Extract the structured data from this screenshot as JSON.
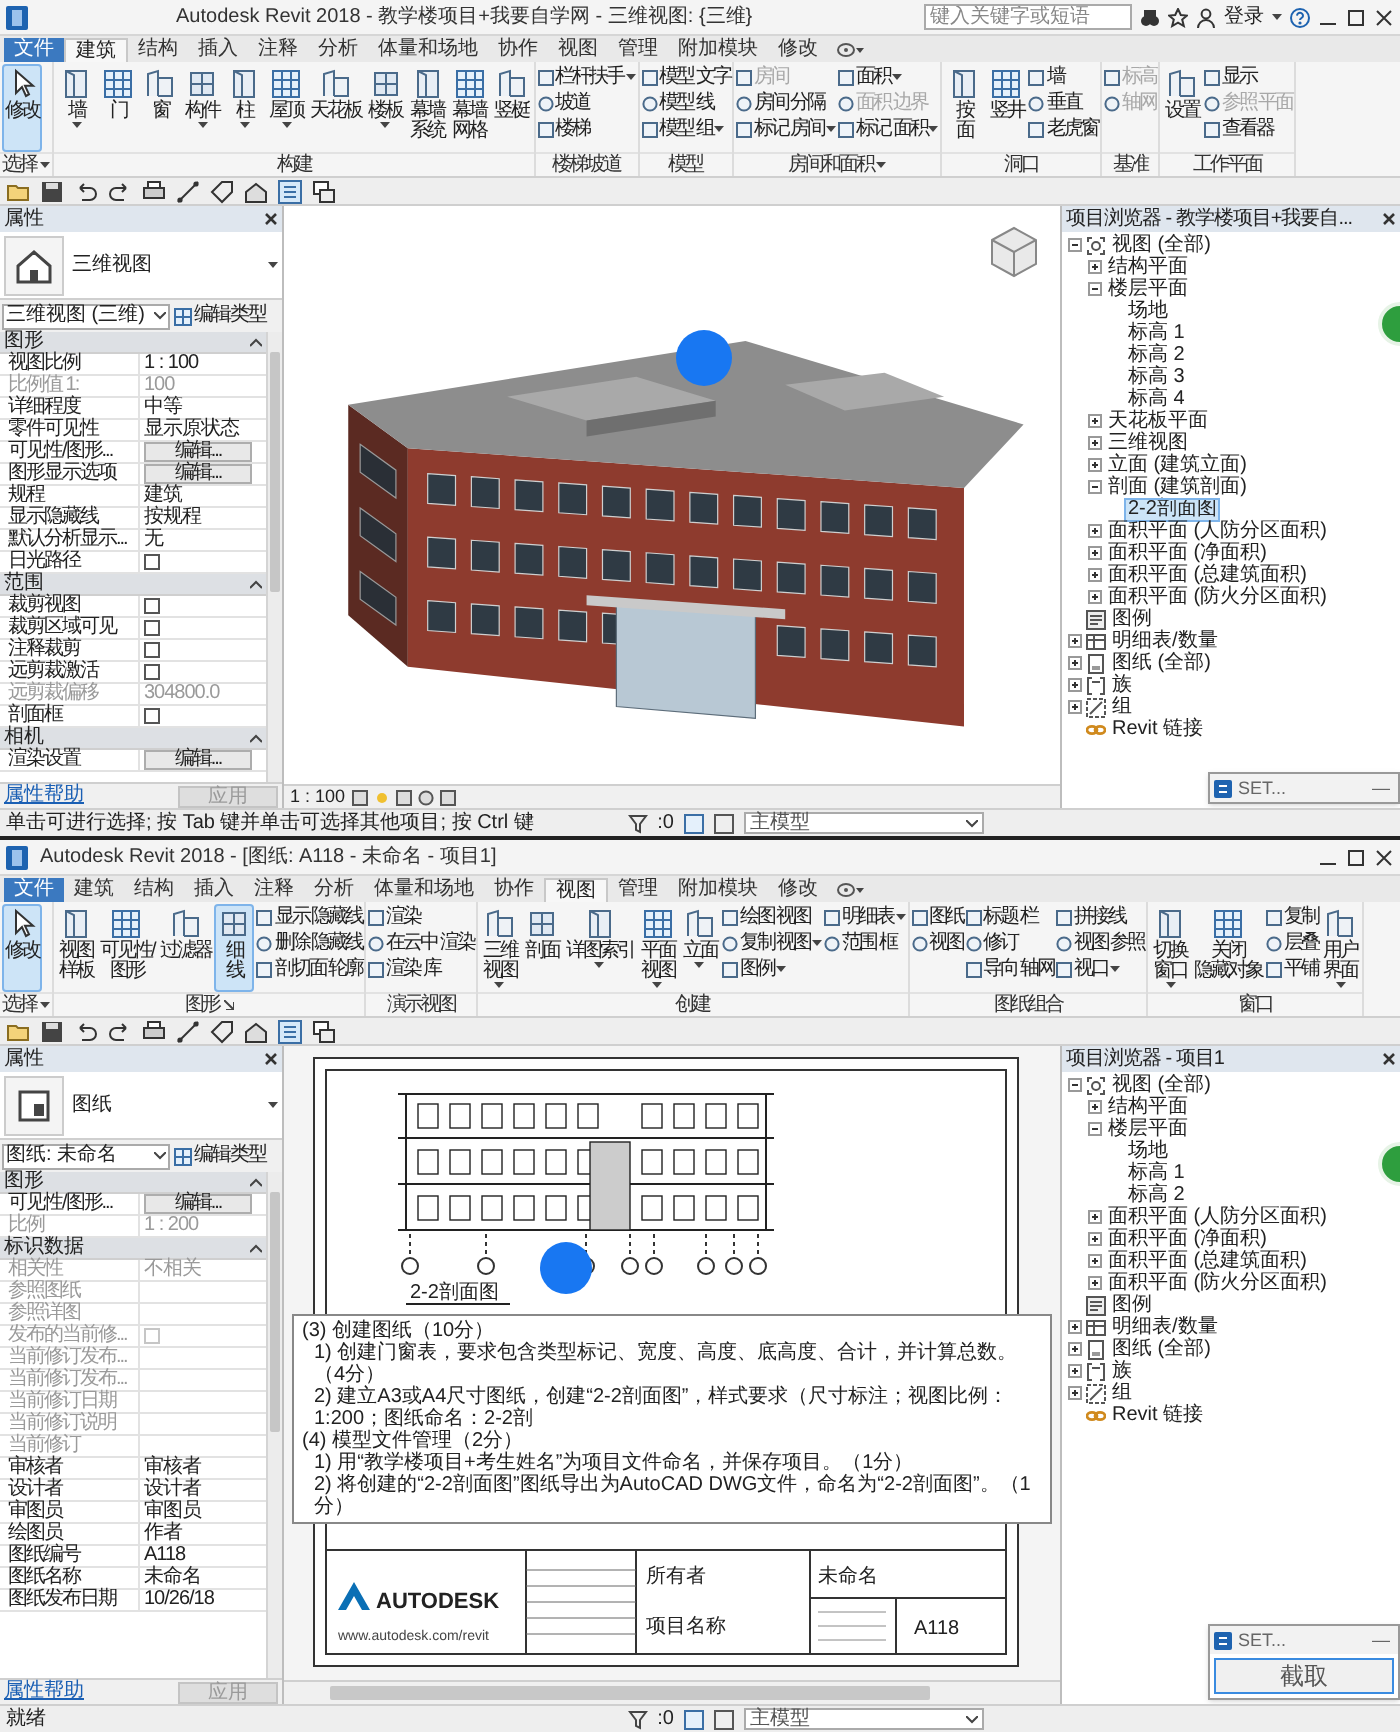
{
  "windows": [
    {
      "title": "Autodesk Revit 2018 - 教学楼项目+我要自学网 - 三维视图: {三维}",
      "search": {
        "placeholder": "键入关键字或短语"
      },
      "login": "登录",
      "tabs": [
        {
          "label": "文件",
          "kind": "file",
          "selected": false
        },
        {
          "label": "建筑",
          "kind": "tab",
          "selected": true
        },
        {
          "label": "结构",
          "kind": "tab",
          "selected": false
        },
        {
          "label": "插入",
          "kind": "tab",
          "selected": false
        },
        {
          "label": "注释",
          "kind": "tab",
          "selected": false
        },
        {
          "label": "分析",
          "kind": "tab",
          "selected": false
        },
        {
          "label": "体量和场地",
          "kind": "tab",
          "selected": false
        },
        {
          "label": "协作",
          "kind": "tab",
          "selected": false
        },
        {
          "label": "视图",
          "kind": "tab",
          "selected": false
        },
        {
          "label": "管理",
          "kind": "tab",
          "selected": false
        },
        {
          "label": "附加模块",
          "kind": "tab",
          "selected": false
        },
        {
          "label": "修改",
          "kind": "tab",
          "selected": false
        }
      ],
      "ribbon": [
        {
          "label": "选择",
          "dropdown": true,
          "launcher": false,
          "items": [
            {
              "kind": "large",
              "lines": [
                "修改"
              ],
              "dropdown": false,
              "selected": true
            }
          ]
        },
        {
          "label": "构建",
          "dropdown": false,
          "launcher": false,
          "items": [
            {
              "kind": "large",
              "lines": [
                "墙"
              ],
              "dropdown": true,
              "selected": false
            },
            {
              "kind": "large",
              "lines": [
                "门"
              ],
              "dropdown": false,
              "selected": false
            },
            {
              "kind": "large",
              "lines": [
                "窗"
              ],
              "dropdown": false,
              "selected": false
            },
            {
              "kind": "large",
              "lines": [
                "构件"
              ],
              "dropdown": true,
              "selected": false
            },
            {
              "kind": "large",
              "lines": [
                "柱"
              ],
              "dropdown": true,
              "selected": false
            },
            {
              "kind": "large",
              "lines": [
                "屋顶"
              ],
              "dropdown": true,
              "selected": false
            },
            {
              "kind": "large",
              "lines": [
                "天花板"
              ],
              "dropdown": false,
              "selected": false
            },
            {
              "kind": "large",
              "lines": [
                "楼板"
              ],
              "dropdown": true,
              "selected": false
            },
            {
              "kind": "large",
              "lines": [
                "幕墙",
                "系统"
              ],
              "dropdown": false,
              "selected": false
            },
            {
              "kind": "large",
              "lines": [
                "幕墙",
                "网格"
              ],
              "dropdown": false,
              "selected": false
            },
            {
              "kind": "large",
              "lines": [
                "竖梃"
              ],
              "dropdown": false,
              "selected": false
            }
          ]
        },
        {
          "label": "楼梯坡道",
          "dropdown": false,
          "launcher": false,
          "items": [
            {
              "kind": "column",
              "items": [
                {
                  "label": "栏杆扶手",
                  "dropdown": true,
                  "disabled": false
                },
                {
                  "label": "坡道",
                  "dropdown": false,
                  "disabled": false
                },
                {
                  "label": "楼梯",
                  "dropdown": false,
                  "disabled": false
                }
              ]
            }
          ]
        },
        {
          "label": "模型",
          "dropdown": false,
          "launcher": false,
          "items": [
            {
              "kind": "column",
              "items": [
                {
                  "label": "模型 文字",
                  "dropdown": false,
                  "disabled": false
                },
                {
                  "label": "模型 线",
                  "dropdown": false,
                  "disabled": false
                },
                {
                  "label": "模型 组",
                  "dropdown": true,
                  "disabled": false
                }
              ]
            }
          ]
        },
        {
          "label": "房间和面积",
          "dropdown": true,
          "launcher": false,
          "items": [
            {
              "kind": "column",
              "items": [
                {
                  "label": "房间",
                  "dropdown": false,
                  "disabled": true
                },
                {
                  "label": "房间 分隔",
                  "dropdown": false,
                  "disabled": false
                },
                {
                  "label": "标记 房间",
                  "dropdown": true,
                  "disabled": false
                }
              ]
            },
            {
              "kind": "column",
              "items": [
                {
                  "label": "面积",
                  "dropdown": true,
                  "disabled": false
                },
                {
                  "label": "面积 边界",
                  "dropdown": false,
                  "disabled": true
                },
                {
                  "label": "标记 面积",
                  "dropdown": true,
                  "disabled": false
                }
              ]
            }
          ]
        },
        {
          "label": "洞口",
          "dropdown": false,
          "launcher": false,
          "items": [
            {
              "kind": "large",
              "lines": [
                "按",
                "面"
              ],
              "dropdown": false,
              "selected": false
            },
            {
              "kind": "large",
              "lines": [
                "竖井"
              ],
              "dropdown": false,
              "selected": false
            },
            {
              "kind": "column",
              "items": [
                {
                  "label": "墙",
                  "dropdown": false,
                  "disabled": false
                },
                {
                  "label": "垂直",
                  "dropdown": false,
                  "disabled": false
                },
                {
                  "label": "老虎窗",
                  "dropdown": false,
                  "disabled": false
                }
              ]
            }
          ]
        },
        {
          "label": "基准",
          "dropdown": false,
          "launcher": false,
          "items": [
            {
              "kind": "column",
              "items": [
                {
                  "label": "标高",
                  "dropdown": false,
                  "disabled": true
                },
                {
                  "label": "轴网",
                  "dropdown": false,
                  "disabled": true
                }
              ]
            }
          ]
        },
        {
          "label": "工作平面",
          "dropdown": false,
          "launcher": false,
          "items": [
            {
              "kind": "large",
              "lines": [
                "设置"
              ],
              "dropdown": false,
              "selected": false
            },
            {
              "kind": "column",
              "items": [
                {
                  "label": "显示",
                  "dropdown": false,
                  "disabled": false
                },
                {
                  "label": "参照 平面",
                  "dropdown": false,
                  "disabled": true
                },
                {
                  "label": "查看器",
                  "dropdown": false,
                  "disabled": false
                }
              ]
            }
          ]
        }
      ],
      "properties": {
        "title": "属性",
        "type_name": "三维视图",
        "selector": "三维视图 (三维)",
        "edit_type": "编辑类型",
        "rows": [
          {
            "kind": "section",
            "label": "图形",
            "expanded": true
          },
          {
            "kind": "text",
            "label": "视图比例",
            "value": "1 : 100",
            "disabled": false
          },
          {
            "kind": "text",
            "label": "比例值 1:",
            "value": "100",
            "disabled": true
          },
          {
            "kind": "text",
            "label": "详细程度",
            "value": "中等",
            "disabled": false
          },
          {
            "kind": "text",
            "label": "零件可见性",
            "value": "显示原状态",
            "disabled": false
          },
          {
            "kind": "button",
            "label": "可见性/图形...",
            "value": "编辑...",
            "disabled": false
          },
          {
            "kind": "button",
            "label": "图形显示选项",
            "value": "编辑...",
            "disabled": false
          },
          {
            "kind": "text",
            "label": "规程",
            "value": "建筑",
            "disabled": false
          },
          {
            "kind": "text",
            "label": "显示隐藏线",
            "value": "按规程",
            "disabled": false
          },
          {
            "kind": "text",
            "label": "默认分析显示...",
            "value": "无",
            "disabled": false
          },
          {
            "kind": "checkbox",
            "label": "日光路径",
            "checked": false,
            "disabled": false
          },
          {
            "kind": "section",
            "label": "范围",
            "expanded": true
          },
          {
            "kind": "checkbox",
            "label": "裁剪视图",
            "checked": false,
            "disabled": false
          },
          {
            "kind": "checkbox",
            "label": "裁剪区域可见",
            "checked": false,
            "disabled": false
          },
          {
            "kind": "checkbox",
            "label": "注释裁剪",
            "checked": false,
            "disabled": false
          },
          {
            "kind": "checkbox",
            "label": "远剪裁激活",
            "checked": false,
            "disabled": false
          },
          {
            "kind": "text",
            "label": "远剪裁偏移",
            "value": "304800.0",
            "disabled": true
          },
          {
            "kind": "checkbox",
            "label": "剖面框",
            "checked": false,
            "disabled": false
          },
          {
            "kind": "section",
            "label": "相机",
            "expanded": true
          },
          {
            "kind": "button",
            "label": "渲染设置",
            "value": "编辑...",
            "disabled": false
          }
        ],
        "help": "属性帮助",
        "apply": "应用"
      },
      "view": {
        "kind": "model3d",
        "scale": "1 : 100"
      },
      "browser": {
        "title": "项目浏览器 - 教学楼项目+我要自...",
        "tree": [
          {
            "label": "视图 (全部)",
            "kind": "views",
            "expanded": true,
            "selected": false,
            "children": [
              {
                "label": "结构平面",
                "expanded": false,
                "selected": false
              },
              {
                "label": "楼层平面",
                "expanded": true,
                "selected": false,
                "children": [
                  {
                    "label": "场地",
                    "selected": false
                  },
                  {
                    "label": "标高 1",
                    "selected": false
                  },
                  {
                    "label": "标高 2",
                    "selected": false
                  },
                  {
                    "label": "标高 3",
                    "selected": false
                  },
                  {
                    "label": "标高 4",
                    "selected": false
                  }
                ]
              },
              {
                "label": "天花板平面",
                "expanded": false,
                "selected": false
              },
              {
                "label": "三维视图",
                "expanded": false,
                "selected": false
              },
              {
                "label": "立面 (建筑立面)",
                "expanded": false,
                "selected": false
              },
              {
                "label": "剖面 (建筑剖面)",
                "expanded": true,
                "selected": false,
                "children": [
                  {
                    "label": "2-2剖面图",
                    "selected": true
                  }
                ]
              },
              {
                "label": "面积平面 (人防分区面积)",
                "expanded": false,
                "selected": false
              },
              {
                "label": "面积平面 (净面积)",
                "expanded": false,
                "selected": false
              },
              {
                "label": "面积平面 (总建筑面积)",
                "expanded": false,
                "selected": false
              },
              {
                "label": "面积平面 (防火分区面积)",
                "expanded": false,
                "selected": false
              }
            ]
          },
          {
            "label": "图例",
            "kind": "legend",
            "selected": false
          },
          {
            "label": "明细表/数量",
            "kind": "schedule",
            "expanded": false,
            "selected": false
          },
          {
            "label": "图纸 (全部)",
            "kind": "sheets",
            "expanded": false,
            "selected": false
          },
          {
            "label": "族",
            "kind": "family",
            "expanded": false,
            "selected": false
          },
          {
            "label": "组",
            "kind": "group",
            "expanded": false,
            "selected": false
          },
          {
            "label": "Revit 链接",
            "kind": "link",
            "selected": false
          }
        ]
      },
      "popup": {
        "title": "SET...",
        "minimize": "—"
      },
      "status_bar": {
        "text": "单击可进行选择; 按 Tab 键并单击可选择其他项目; 按 Ctrl 键",
        "count": ":0",
        "model": "主模型"
      }
    },
    {
      "title": "Autodesk Revit 2018 - [图纸: A118 - 未命名 - 项目1]",
      "tabs": [
        {
          "label": "文件",
          "kind": "file",
          "selected": false
        },
        {
          "label": "建筑",
          "kind": "tab",
          "selected": false
        },
        {
          "label": "结构",
          "kind": "tab",
          "selected": false
        },
        {
          "label": "插入",
          "kind": "tab",
          "selected": false
        },
        {
          "label": "注释",
          "kind": "tab",
          "selected": false
        },
        {
          "label": "分析",
          "kind": "tab",
          "selected": false
        },
        {
          "label": "体量和场地",
          "kind": "tab",
          "selected": false
        },
        {
          "label": "协作",
          "kind": "tab",
          "selected": false
        },
        {
          "label": "视图",
          "kind": "tab",
          "selected": true
        },
        {
          "label": "管理",
          "kind": "tab",
          "selected": false
        },
        {
          "label": "附加模块",
          "kind": "tab",
          "selected": false
        },
        {
          "label": "修改",
          "kind": "tab",
          "selected": false
        }
      ],
      "ribbon": [
        {
          "label": "选择",
          "dropdown": true,
          "launcher": false,
          "items": [
            {
              "kind": "large",
              "lines": [
                "修改"
              ],
              "dropdown": false,
              "selected": true
            }
          ]
        },
        {
          "label": "图形",
          "dropdown": false,
          "launcher": true,
          "items": [
            {
              "kind": "large",
              "lines": [
                "视图",
                "样板"
              ],
              "dropdown": false,
              "selected": false
            },
            {
              "kind": "large",
              "lines": [
                "可见性/",
                "图形"
              ],
              "dropdown": false,
              "selected": false
            },
            {
              "kind": "large",
              "lines": [
                "过滤器"
              ],
              "dropdown": false,
              "selected": false
            },
            {
              "kind": "large",
              "lines": [
                "细",
                "线"
              ],
              "dropdown": false,
              "selected": true
            },
            {
              "kind": "column",
              "items": [
                {
                  "label": "显示 隐藏线",
                  "dropdown": false,
                  "disabled": false
                },
                {
                  "label": "删除 隐藏线",
                  "dropdown": false,
                  "disabled": false
                },
                {
                  "label": "剖切面 轮廓",
                  "dropdown": false,
                  "disabled": false
                }
              ]
            }
          ]
        },
        {
          "label": "演示视图",
          "dropdown": false,
          "launcher": false,
          "items": [
            {
              "kind": "column",
              "items": [
                {
                  "label": "渲染",
                  "dropdown": false,
                  "disabled": false
                },
                {
                  "label": "在云中 渲染",
                  "dropdown": false,
                  "disabled": false
                },
                {
                  "label": "渲染 库",
                  "dropdown": false,
                  "disabled": false
                }
              ]
            }
          ]
        },
        {
          "label": "创建",
          "dropdown": false,
          "launcher": false,
          "items": [
            {
              "kind": "large",
              "lines": [
                "三维",
                "视图"
              ],
              "dropdown": true,
              "selected": false
            },
            {
              "kind": "large",
              "lines": [
                "剖面"
              ],
              "dropdown": false,
              "selected": false
            },
            {
              "kind": "large",
              "lines": [
                "详图索引"
              ],
              "dropdown": true,
              "selected": false
            },
            {
              "kind": "large",
              "lines": [
                "平面",
                "视图"
              ],
              "dropdown": true,
              "selected": false
            },
            {
              "kind": "large",
              "lines": [
                "立面"
              ],
              "dropdown": true,
              "selected": false
            },
            {
              "kind": "column",
              "items": [
                {
                  "label": "绘图 视图",
                  "dropdown": false,
                  "disabled": false
                },
                {
                  "label": "复制 视图",
                  "dropdown": true,
                  "disabled": false
                },
                {
                  "label": "图例",
                  "dropdown": true,
                  "disabled": false
                }
              ]
            },
            {
              "kind": "column",
              "items": [
                {
                  "label": "明细表",
                  "dropdown": true,
                  "disabled": false
                },
                {
                  "label": "范围 框",
                  "dropdown": false,
                  "disabled": false
                }
              ]
            }
          ]
        },
        {
          "label": "图纸组合",
          "dropdown": false,
          "launcher": false,
          "items": [
            {
              "kind": "column",
              "items": [
                {
                  "label": "图纸",
                  "dropdown": false,
                  "disabled": false
                },
                {
                  "label": "视图",
                  "dropdown": false,
                  "disabled": false
                }
              ]
            },
            {
              "kind": "column",
              "items": [
                {
                  "label": "标题 栏",
                  "dropdown": false,
                  "disabled": false
                },
                {
                  "label": "修订",
                  "dropdown": false,
                  "disabled": false
                },
                {
                  "label": "导向 轴网",
                  "dropdown": false,
                  "disabled": false
                }
              ]
            },
            {
              "kind": "column",
              "items": [
                {
                  "label": "拼接线",
                  "dropdown": false,
                  "disabled": false
                },
                {
                  "label": "视图 参照",
                  "dropdown": false,
                  "disabled": false
                },
                {
                  "label": "视口",
                  "dropdown": true,
                  "disabled": false
                }
              ]
            }
          ]
        },
        {
          "label": "窗口",
          "dropdown": false,
          "launcher": false,
          "items": [
            {
              "kind": "large",
              "lines": [
                "切换",
                "窗口"
              ],
              "dropdown": true,
              "selected": false
            },
            {
              "kind": "large",
              "lines": [
                "关闭",
                "隐藏对象"
              ],
              "dropdown": false,
              "selected": false
            },
            {
              "kind": "column",
              "items": [
                {
                  "label": "复制",
                  "dropdown": false,
                  "disabled": false
                },
                {
                  "label": "层叠",
                  "dropdown": false,
                  "disabled": false
                },
                {
                  "label": "平铺",
                  "dropdown": false,
                  "disabled": false
                }
              ]
            },
            {
              "kind": "large",
              "lines": [
                "用户",
                "界面"
              ],
              "dropdown": true,
              "selected": false
            }
          ]
        }
      ],
      "properties": {
        "title": "属性",
        "type_name": "图纸",
        "selector": "图纸: 未命名",
        "edit_type": "编辑类型",
        "rows": [
          {
            "kind": "section",
            "label": "图形",
            "expanded": true
          },
          {
            "kind": "button",
            "label": "可见性/图形...",
            "value": "编辑...",
            "disabled": false
          },
          {
            "kind": "text",
            "label": "比例",
            "value": "1 : 200",
            "disabled": true
          },
          {
            "kind": "section",
            "label": "标识数据",
            "expanded": true
          },
          {
            "kind": "text",
            "label": "相关性",
            "value": "不相关",
            "disabled": true
          },
          {
            "kind": "text",
            "label": "参照图纸",
            "disabled": true
          },
          {
            "kind": "text",
            "label": "参照详图",
            "disabled": true
          },
          {
            "kind": "checkbox",
            "label": "发布的当前修...",
            "checked": false,
            "disabled": true
          },
          {
            "kind": "text",
            "label": "当前修订发布...",
            "disabled": true
          },
          {
            "kind": "text",
            "label": "当前修订发布...",
            "disabled": true
          },
          {
            "kind": "text",
            "label": "当前修订日期",
            "disabled": true
          },
          {
            "kind": "text",
            "label": "当前修订说明",
            "disabled": true
          },
          {
            "kind": "text",
            "label": "当前修订",
            "disabled": true
          },
          {
            "kind": "text",
            "label": "审核者",
            "value": "审核者",
            "disabled": false
          },
          {
            "kind": "text",
            "label": "设计者",
            "value": "设计者",
            "disabled": false
          },
          {
            "kind": "text",
            "label": "审图员",
            "value": "审图员",
            "disabled": false
          },
          {
            "kind": "text",
            "label": "绘图员",
            "value": "作者",
            "disabled": false
          },
          {
            "kind": "text",
            "label": "图纸编号",
            "value": "A118",
            "disabled": false
          },
          {
            "kind": "text",
            "label": "图纸名称",
            "value": "未命名",
            "disabled": false
          },
          {
            "kind": "text",
            "label": "图纸发布日期",
            "value": "10/26/18",
            "disabled": false
          }
        ],
        "help": "属性帮助",
        "apply": "应用"
      },
      "view": {
        "kind": "sheet",
        "view_label": "2-2剖面图",
        "logo": "AUTODESK",
        "website": "www.autodesk.com/revit",
        "owner": "所有者",
        "project_name": "项目名称",
        "sheet_name": "未命名",
        "sheet_number": "A118",
        "note": [
          {
            "kind": "heading",
            "text": "(3) 创建图纸（10分）"
          },
          {
            "kind": "item",
            "text": "1) 创建门窗表，要求包含类型标记、宽度、高度、底高度、合计，并计算总数。（4分）"
          },
          {
            "kind": "item",
            "text": "2) 建立A3或A4尺寸图纸，创建“2-2剖面图”，样式要求（尺寸标注；视图比例：1:200；图纸命名：2-2剖"
          },
          {
            "kind": "heading",
            "text": "(4) 模型文件管理（2分）"
          },
          {
            "kind": "item",
            "text": "1) 用“教学楼项目+考生姓名”为项目文件命名，并保存项目。（1分）"
          },
          {
            "kind": "item",
            "text": "2) 将创建的“2-2剖面图”图纸导出为AutoCAD DWG文件，命名为“2-2剖面图”。（1分）"
          }
        ]
      },
      "browser": {
        "title": "项目浏览器 - 项目1",
        "tree": [
          {
            "label": "视图 (全部)",
            "kind": "views",
            "expanded": true,
            "selected": false,
            "children": [
              {
                "label": "结构平面",
                "expanded": false,
                "selected": false
              },
              {
                "label": "楼层平面",
                "expanded": true,
                "selected": false,
                "children": [
                  {
                    "label": "场地",
                    "selected": false
                  },
                  {
                    "label": "标高 1",
                    "selected": false
                  },
                  {
                    "label": "标高 2",
                    "selected": false
                  }
                ]
              },
              {
                "label": "面积平面 (人防分区面积)",
                "expanded": false,
                "selected": false
              },
              {
                "label": "面积平面 (净面积)",
                "expanded": false,
                "selected": false
              },
              {
                "label": "面积平面 (总建筑面积)",
                "expanded": false,
                "selected": false
              },
              {
                "label": "面积平面 (防火分区面积)",
                "expanded": false,
                "selected": false
              }
            ]
          },
          {
            "label": "图例",
            "kind": "legend",
            "selected": false
          },
          {
            "label": "明细表/数量",
            "kind": "schedule",
            "expanded": false,
            "selected": false
          },
          {
            "label": "图纸 (全部)",
            "kind": "sheets",
            "expanded": false,
            "selected": false
          },
          {
            "label": "族",
            "kind": "family",
            "expanded": false,
            "selected": false
          },
          {
            "label": "组",
            "kind": "group",
            "expanded": false,
            "selected": false
          },
          {
            "label": "Revit 链接",
            "kind": "link",
            "selected": false
          }
        ]
      },
      "popup": {
        "title": "SET...",
        "minimize": "—",
        "capture": "截取"
      },
      "status_bar": {
        "text": "就绪",
        "count": ":0",
        "model": "主模型"
      }
    }
  ]
}
